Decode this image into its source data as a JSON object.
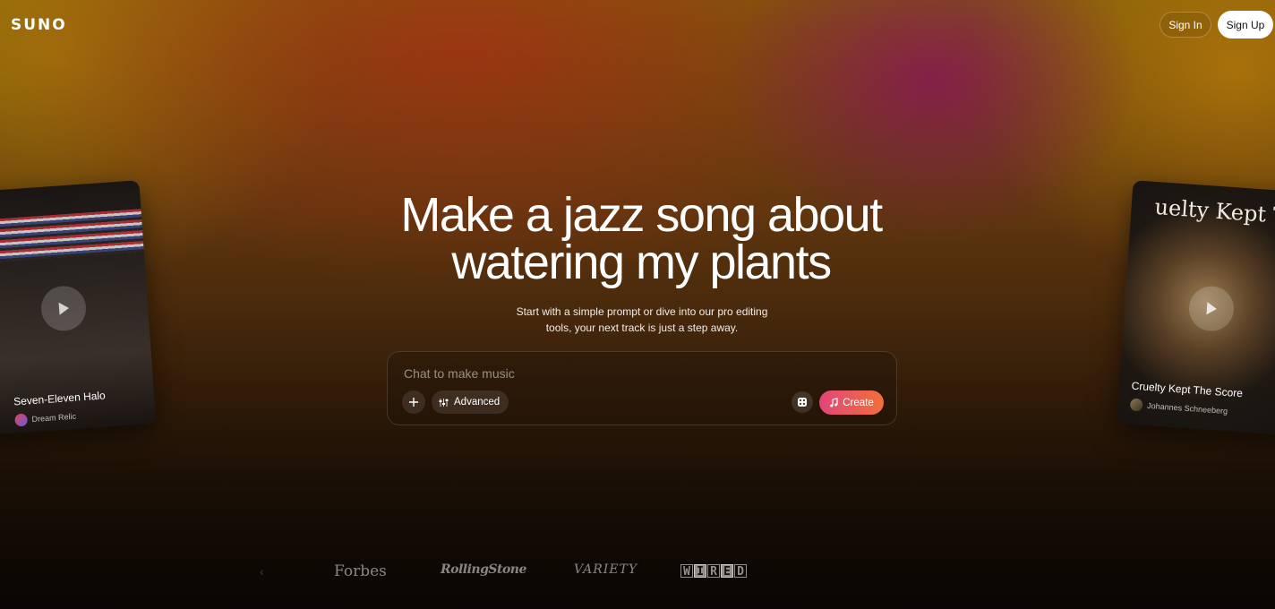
{
  "header": {
    "logo": "SUNO",
    "sign_in": "Sign In",
    "sign_up": "Sign Up"
  },
  "hero": {
    "title_line1": "Make a jazz song about",
    "title_line2": "watering my plants",
    "subtitle_line1": "Start with a simple prompt or dive into our pro editing",
    "subtitle_line2": "tools, your next track is just a step away."
  },
  "prompt": {
    "placeholder": "Chat to make music",
    "advanced_label": "Advanced",
    "create_label": "Create",
    "add_icon": "plus-icon",
    "advanced_icon": "sliders-icon",
    "dice_icon": "dice-icon",
    "create_icon": "music-note-icon"
  },
  "cards": [
    {
      "title": "Seven-Eleven Halo",
      "artist": "Dream Relic"
    },
    {
      "title": "Cruelty Kept The Score",
      "artist": "Johannes Schneeberg",
      "cover_text": "uelty Kept The"
    }
  ],
  "press": {
    "faded": "‹",
    "forbes": "Forbes",
    "rolling_stone": "RollingStone",
    "variety": "VARIETY",
    "wired": [
      "W",
      "I",
      "R",
      "E",
      "D"
    ]
  },
  "colors": {
    "create_gradient_start": "#e2457a",
    "create_gradient_end": "#f0703a",
    "sign_up_bg": "#ffffff"
  }
}
